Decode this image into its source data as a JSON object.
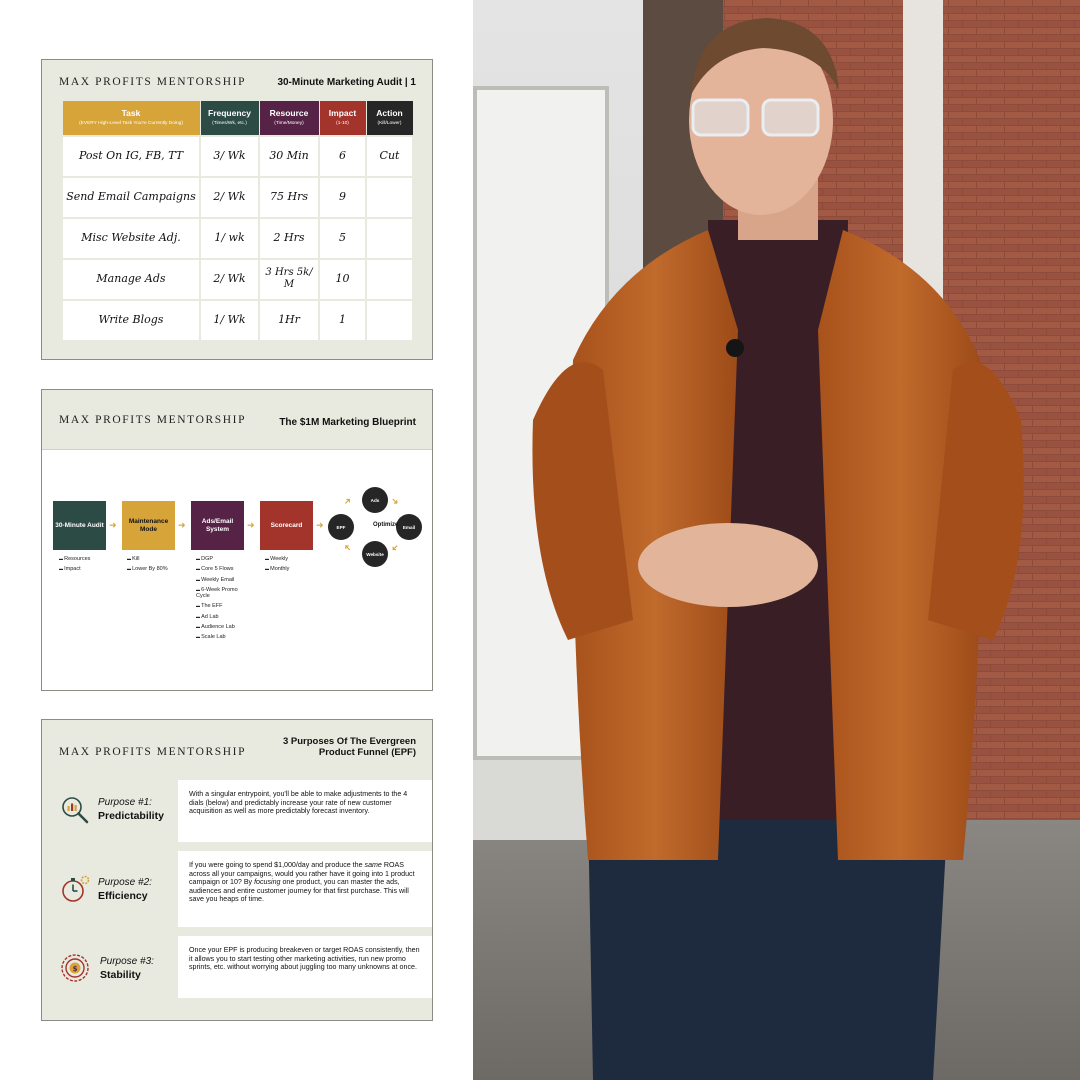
{
  "brand": "MAX PROFITS MENTORSHIP",
  "slide1": {
    "title": "30-Minute Marketing Audit | 1",
    "headers": [
      {
        "label": "Task",
        "sub": "(EVERY High-Level Task You're Currently Doing)",
        "color": "#d7a43a"
      },
      {
        "label": "Frequency",
        "sub": "(Times/Wk, etc.)",
        "color": "#2d4b45"
      },
      {
        "label": "Resource",
        "sub": "(Time/Money)",
        "color": "#562347"
      },
      {
        "label": "Impact",
        "sub": "(1-10)",
        "color": "#a3342c"
      },
      {
        "label": "Action",
        "sub": "(Kill/Lower)",
        "color": "#262626"
      }
    ],
    "rows": [
      [
        "Post On IG, FB, TT",
        "3/ Wk",
        "30 Min",
        "6",
        "Cut"
      ],
      [
        "Send Email Campaigns",
        "2/ Wk",
        "75 Hrs",
        "9",
        ""
      ],
      [
        "Misc Website Adj.",
        "1/ wk",
        "2 Hrs",
        "5",
        ""
      ],
      [
        "Manage Ads",
        "2/ Wk",
        "3 Hrs 5k/ M",
        "10",
        ""
      ],
      [
        "Write Blogs",
        "1/ Wk",
        "1Hr",
        "1",
        ""
      ]
    ]
  },
  "slide2": {
    "title": "The $1M Marketing Blueprint",
    "steps": [
      {
        "label": "30-Minute Audit",
        "color": "#2d4b45",
        "items": [
          "Resources",
          "Impact"
        ]
      },
      {
        "label": "Maintenance Mode",
        "color": "#d7a43a",
        "items": [
          "Kill",
          "Lower By 80%"
        ]
      },
      {
        "label": "Ads/Email System",
        "color": "#562347",
        "items": [
          "DGP",
          "Core 5 Flows",
          "Weekly Email",
          "6-Week Promo Cycle",
          "The EFF",
          "Ad Lab",
          "Audience Lab",
          "Scale Lab"
        ]
      },
      {
        "label": "Scorecard",
        "color": "#a3342c",
        "items": [
          "Weekly",
          "Monthly"
        ]
      }
    ],
    "cycle": {
      "center": "Optimize",
      "top": "Ads",
      "right": "Email",
      "bottom": "Website",
      "left": "EPF"
    }
  },
  "slide3": {
    "title_line1": "3 Purposes Of The Evergreen",
    "title_line2": "Product Funnel (EPF)",
    "purposes": [
      {
        "num": "Purpose #1:",
        "name": "Predictability",
        "icon": "magnifier-chart-icon",
        "text": "With a singular entrypoint, you'll be able to make adjustments to the 4 dials (below) and predictably increase your rate of new customer acquisition as well as more predictably forecast inventory."
      },
      {
        "num": "Purpose #2:",
        "name": "Efficiency",
        "icon": "stopwatch-gear-icon",
        "text_a": "If you were going to spend $1,000/day and produce the ",
        "text_b": "same",
        "text_c": " ROAS across all your campaigns, would you rather have it going into 1 product campaign or 10? By ",
        "text_d": "focusing",
        "text_e": " one product, you can master the ads, audiences and entire customer journey for that first purchase. This will save you heaps of time."
      },
      {
        "num": "Purpose #3:",
        "name": "Stability",
        "icon": "target-coin-icon",
        "text": "Once your EPF is producing breakeven or target ROAS consistently, then it allows you to start testing other marketing activities, run new promo sprints, etc. without worrying about juggling too many unknowns at once."
      }
    ]
  },
  "colors": {
    "gold": "#d7a43a",
    "green": "#2d4b45",
    "plum": "#562347",
    "red": "#a3342c",
    "black": "#262626",
    "slide_bg": "#e9eadf"
  }
}
